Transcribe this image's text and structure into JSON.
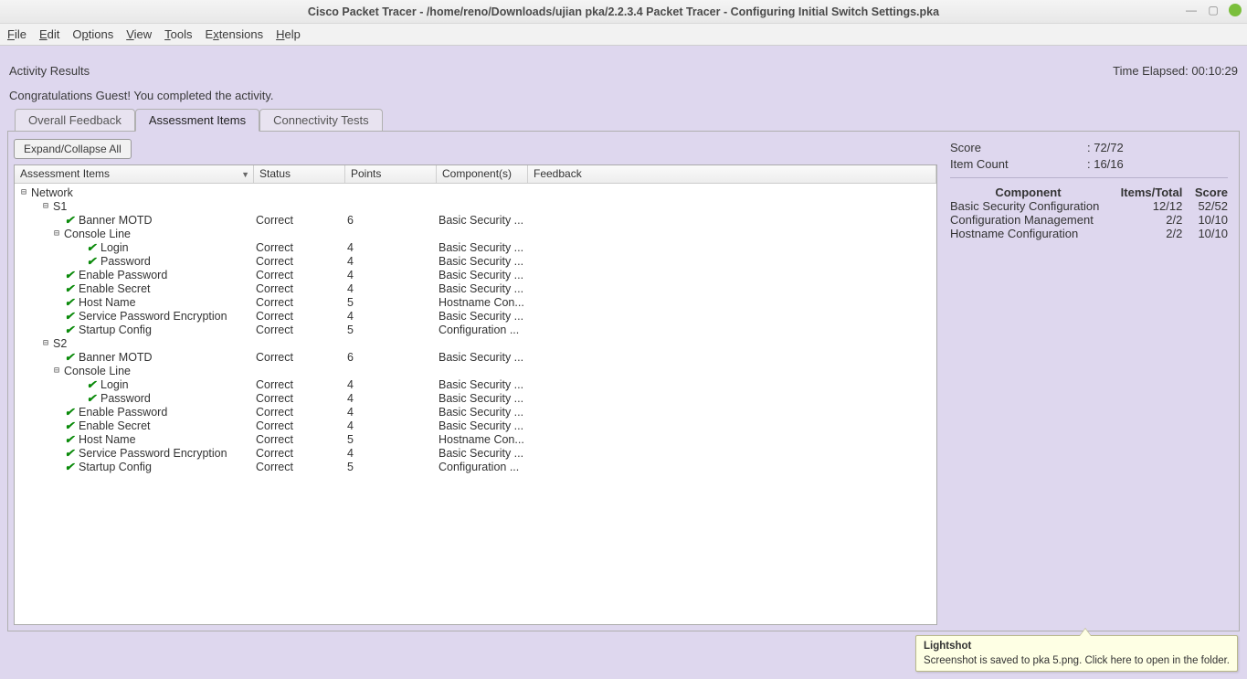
{
  "window": {
    "title": "Cisco Packet Tracer - /home/reno/Downloads/ujian pka/2.2.3.4 Packet Tracer - Configuring Initial Switch Settings.pka"
  },
  "menu": {
    "items": [
      "File",
      "Edit",
      "Options",
      "View",
      "Tools",
      "Extensions",
      "Help"
    ]
  },
  "header": {
    "activity_results": "Activity Results",
    "time_elapsed_label": "Time Elapsed:",
    "time_elapsed_value": "00:10:29",
    "congrats": "Congratulations Guest! You completed the activity."
  },
  "tabs": {
    "overall": "Overall Feedback",
    "assessment": "Assessment Items",
    "connectivity": "Connectivity Tests"
  },
  "buttons": {
    "expand": "Expand/Collapse All"
  },
  "columns": {
    "assessment": "Assessment Items",
    "status": "Status",
    "points": "Points",
    "components": "Component(s)",
    "feedback": "Feedback"
  },
  "tree": {
    "network": "Network",
    "s1": "S1",
    "s2": "S2",
    "console_line": "Console Line",
    "status_correct": "Correct",
    "items_s1": [
      {
        "label": "Banner MOTD",
        "points": "6",
        "comp": "Basic Security ..."
      },
      {
        "label": "Login",
        "points": "4",
        "comp": "Basic Security ...",
        "deep": true
      },
      {
        "label": "Password",
        "points": "4",
        "comp": "Basic Security ...",
        "deep": true
      },
      {
        "label": "Enable Password",
        "points": "4",
        "comp": "Basic Security ..."
      },
      {
        "label": "Enable Secret",
        "points": "4",
        "comp": "Basic Security ..."
      },
      {
        "label": "Host Name",
        "points": "5",
        "comp": "Hostname Con..."
      },
      {
        "label": "Service Password Encryption",
        "points": "4",
        "comp": "Basic Security ..."
      },
      {
        "label": "Startup Config",
        "points": "5",
        "comp": "Configuration ..."
      }
    ],
    "items_s2": [
      {
        "label": "Banner MOTD",
        "points": "6",
        "comp": "Basic Security ..."
      },
      {
        "label": "Login",
        "points": "4",
        "comp": "Basic Security ...",
        "deep": true
      },
      {
        "label": "Password",
        "points": "4",
        "comp": "Basic Security ...",
        "deep": true
      },
      {
        "label": "Enable Password",
        "points": "4",
        "comp": "Basic Security ..."
      },
      {
        "label": "Enable Secret",
        "points": "4",
        "comp": "Basic Security ..."
      },
      {
        "label": "Host Name",
        "points": "5",
        "comp": "Hostname Con..."
      },
      {
        "label": "Service Password Encryption",
        "points": "4",
        "comp": "Basic Security ..."
      },
      {
        "label": "Startup Config",
        "points": "5",
        "comp": "Configuration ..."
      }
    ]
  },
  "summary": {
    "score_label": "Score",
    "score_value": ": 72/72",
    "item_label": "Item Count",
    "item_value": ": 16/16",
    "col_component": "Component",
    "col_items": "Items/Total",
    "col_score": "Score",
    "rows": [
      {
        "name": "Basic Security Configuration",
        "items": "12/12",
        "score": "52/52"
      },
      {
        "name": "Configuration Management",
        "items": "2/2",
        "score": "10/10"
      },
      {
        "name": "Hostname Configuration",
        "items": "2/2",
        "score": "10/10"
      }
    ]
  },
  "tooltip": {
    "title": "Lightshot",
    "body": "Screenshot is saved to pka 5.png. Click here to open in the folder."
  }
}
